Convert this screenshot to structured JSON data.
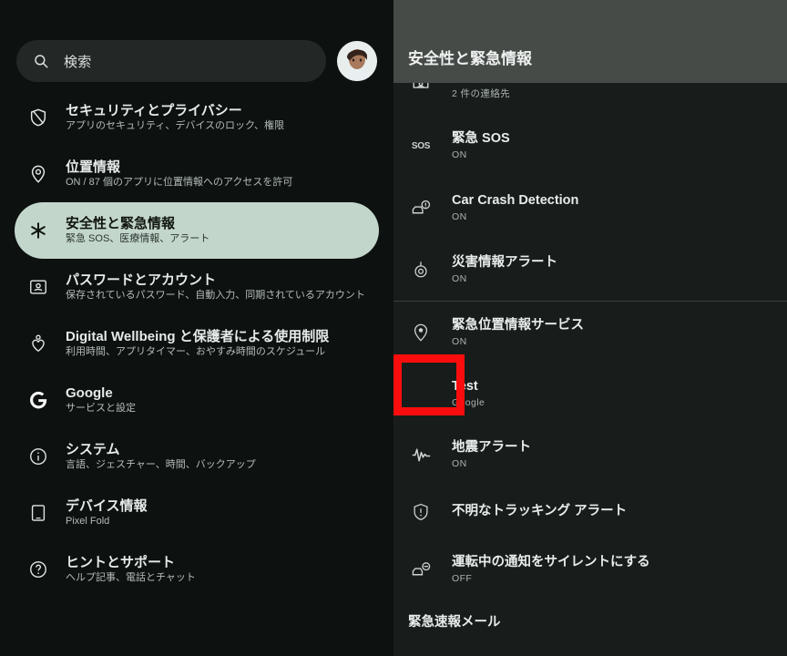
{
  "left_panel": {
    "search": {
      "placeholder": "検索",
      "icon": "search-icon"
    },
    "avatar": {
      "icon": "user-avatar"
    },
    "items": [
      {
        "icon": "shield-privacy-icon",
        "title": "セキュリティとプライバシー",
        "subtitle": "アプリのセキュリティ、デバイスのロック、権限",
        "selected": false
      },
      {
        "icon": "location-pin-icon",
        "title": "位置情報",
        "subtitle": "ON / 87 個のアプリに位置情報へのアクセスを許可",
        "selected": false
      },
      {
        "icon": "asterisk-safety-icon",
        "title": "安全性と緊急情報",
        "subtitle": "緊急 SOS、医療情報、アラート",
        "selected": true
      },
      {
        "icon": "passwords-accounts-icon",
        "title": "パスワードとアカウント",
        "subtitle": "保存されているパスワード、自動入力、同期されているアカウント",
        "selected": false
      },
      {
        "icon": "wellbeing-heart-icon",
        "title": "Digital Wellbeing と保護者による使用制限",
        "subtitle": "利用時間、アプリタイマー、おやすみ時間のスケジュール",
        "selected": false
      },
      {
        "icon": "google-g-icon",
        "title": "Google",
        "subtitle": "サービスと設定",
        "selected": false
      },
      {
        "icon": "info-circle-icon",
        "title": "システム",
        "subtitle": "言語、ジェスチャー、時間、バックアップ",
        "selected": false
      },
      {
        "icon": "tablet-device-icon",
        "title": "デバイス情報",
        "subtitle": "Pixel Fold",
        "selected": false
      },
      {
        "icon": "help-question-icon",
        "title": "ヒントとサポート",
        "subtitle": "ヘルプ記事、電話とチャット",
        "selected": false
      }
    ]
  },
  "right_panel": {
    "header_title": "安全性と緊急情報",
    "items": [
      {
        "icon": "emergency-contacts-icon",
        "title": "",
        "subtitle": "2 件の連絡先",
        "partial": true
      },
      {
        "icon": "sos-icon",
        "title": "緊急 SOS",
        "subtitle": "ON"
      },
      {
        "icon": "car-crash-icon",
        "title": "Car Crash Detection",
        "subtitle": "ON"
      },
      {
        "icon": "disaster-alert-icon",
        "title": "災害情報アラート",
        "subtitle": "ON"
      },
      {
        "icon": "emergency-location-icon",
        "title": "緊急位置情報サービス",
        "subtitle": "ON"
      },
      {
        "icon": "",
        "title": "Test",
        "subtitle": "Google",
        "highlighted": true
      },
      {
        "icon": "earthquake-alert-icon",
        "title": "地震アラート",
        "subtitle": "ON"
      },
      {
        "icon": "unknown-tracker-icon",
        "title": "不明なトラッキング アラート",
        "subtitle": ""
      },
      {
        "icon": "driving-silence-icon",
        "title": "運転中の通知をサイレントにする",
        "subtitle": "OFF"
      }
    ],
    "section_label": "緊急速報メール"
  },
  "colors": {
    "left_bg": "#0d1210",
    "right_bg": "#181d1b",
    "header_bar": "#464b48",
    "selected_item": "#c3d6cc",
    "highlight_red": "#fb0d0d",
    "divider": "#3a403d"
  }
}
